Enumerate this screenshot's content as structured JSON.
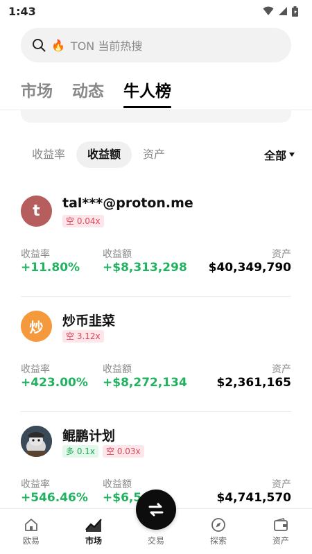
{
  "status_bar": {
    "time": "1:43"
  },
  "search": {
    "placeholder": "TON 当前热搜"
  },
  "top_tabs": [
    {
      "label": "市场",
      "active": false
    },
    {
      "label": "动态",
      "active": false
    },
    {
      "label": "牛人榜",
      "active": true
    }
  ],
  "sub_tabs": [
    {
      "label": "收益率",
      "active": false
    },
    {
      "label": "收益额",
      "active": true
    },
    {
      "label": "资产",
      "active": false
    }
  ],
  "filter": {
    "label": "全部"
  },
  "metric_labels": {
    "rate": "收益率",
    "profit": "收益额",
    "assets": "资产"
  },
  "traders": [
    {
      "avatar_text": "t",
      "name": "tal***@proton.me",
      "tags": [
        {
          "type": "short",
          "text": "空 0.04x"
        }
      ],
      "rate": "+11.80%",
      "profit": "+$8,313,298",
      "assets": "$40,349,790"
    },
    {
      "avatar_text": "炒",
      "name": "炒币韭菜",
      "tags": [
        {
          "type": "short",
          "text": "空 3.12x"
        }
      ],
      "rate": "+423.00%",
      "profit": "+$8,272,134",
      "assets": "$2,361,165"
    },
    {
      "avatar_text": "",
      "name": "鲲鹏计划",
      "tags": [
        {
          "type": "long",
          "text": "多 0.1x"
        },
        {
          "type": "short",
          "text": "空 0.03x"
        }
      ],
      "rate": "+546.46%",
      "profit": "+$6,54",
      "assets": "$4,741,570"
    }
  ],
  "bottom_nav": [
    {
      "label": "欧易",
      "icon": "home-icon",
      "active": false
    },
    {
      "label": "市场",
      "icon": "chart-icon",
      "active": true
    },
    {
      "label": "交易",
      "icon": "swap-icon",
      "active": false
    },
    {
      "label": "探索",
      "icon": "compass-icon",
      "active": false
    },
    {
      "label": "资产",
      "icon": "wallet-icon",
      "active": false
    }
  ],
  "colors": {
    "green": "#22b25f",
    "short_tag": "#e0445a",
    "long_tag": "#1faa58"
  }
}
